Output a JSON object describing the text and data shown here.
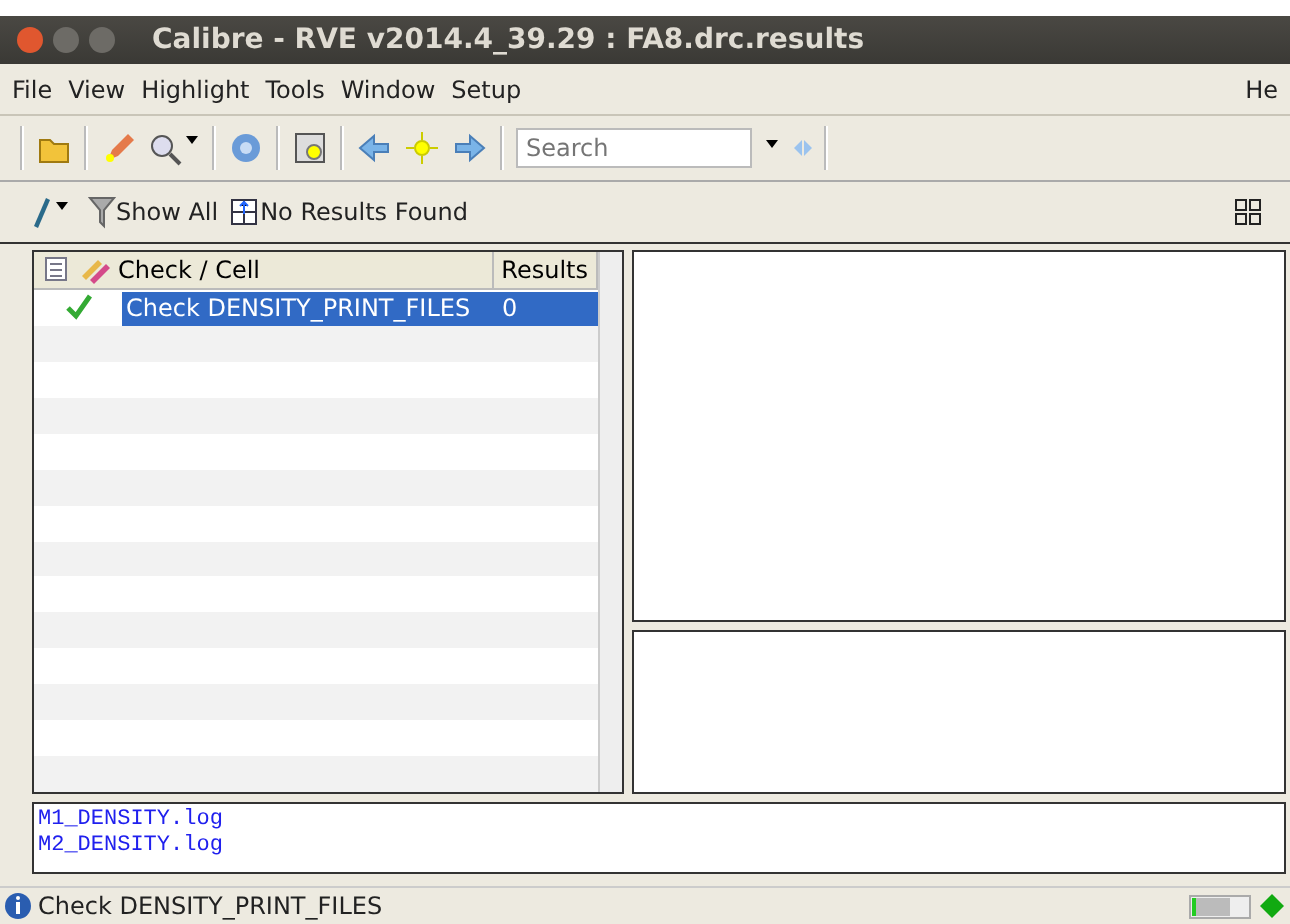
{
  "window": {
    "title": "Calibre - RVE v2014.4_39.29 : FA8.drc.results"
  },
  "menu": [
    "File",
    "View",
    "Highlight",
    "Tools",
    "Window",
    "Setup"
  ],
  "menu_right": "He",
  "search": {
    "placeholder": "Search"
  },
  "filter_bar": {
    "show_all": "Show All",
    "no_results": "No Results Found"
  },
  "tree": {
    "columns": [
      "Check / Cell",
      "Results"
    ],
    "rows": [
      {
        "name": "Check DENSITY_PRINT_FILES",
        "results": "0",
        "checked": true,
        "selected": true
      }
    ]
  },
  "log_lines": [
    "M1_DENSITY.log",
    "M2_DENSITY.log"
  ],
  "status_bar": {
    "message": "Check DENSITY_PRINT_FILES"
  }
}
